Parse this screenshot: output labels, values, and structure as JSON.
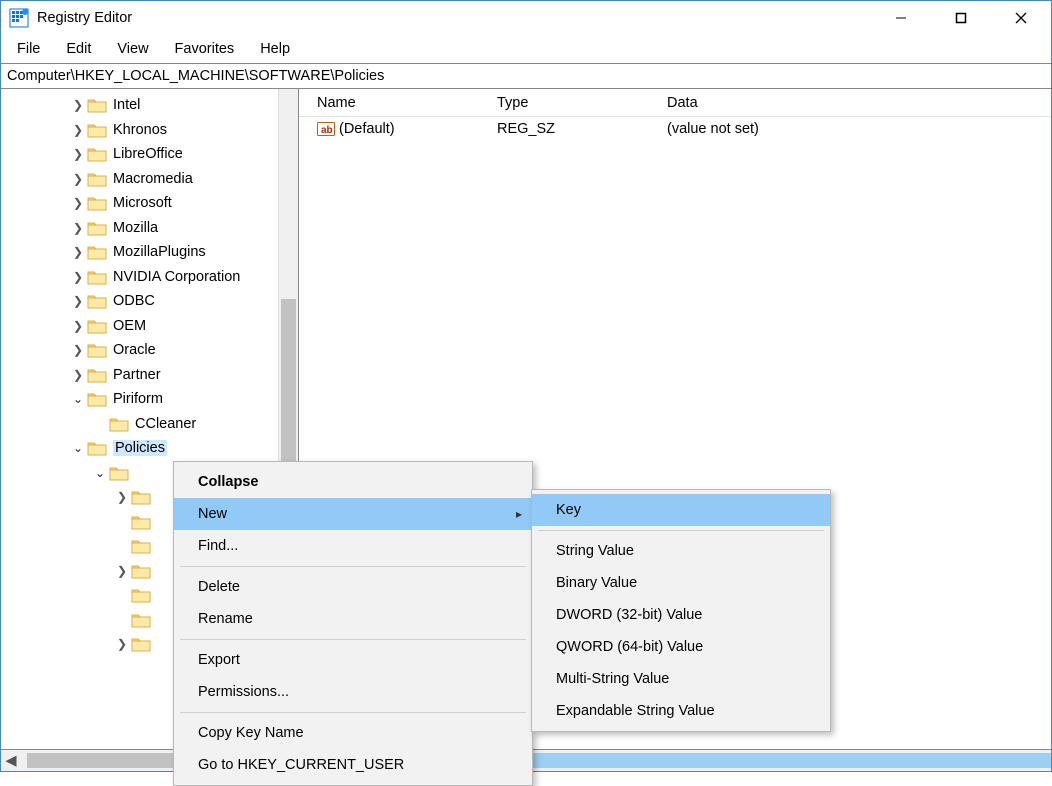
{
  "title": "Registry Editor",
  "menus": [
    "File",
    "Edit",
    "View",
    "Favorites",
    "Help"
  ],
  "address": "Computer\\HKEY_LOCAL_MACHINE\\SOFTWARE\\Policies",
  "tree": [
    {
      "indent": 2,
      "label": "Intel",
      "expand": "closed"
    },
    {
      "indent": 2,
      "label": "Khronos",
      "expand": "closed"
    },
    {
      "indent": 2,
      "label": "LibreOffice",
      "expand": "closed"
    },
    {
      "indent": 2,
      "label": "Macromedia",
      "expand": "closed"
    },
    {
      "indent": 2,
      "label": "Microsoft",
      "expand": "closed"
    },
    {
      "indent": 2,
      "label": "Mozilla",
      "expand": "closed"
    },
    {
      "indent": 2,
      "label": "MozillaPlugins",
      "expand": "closed"
    },
    {
      "indent": 2,
      "label": "NVIDIA Corporation",
      "expand": "closed"
    },
    {
      "indent": 2,
      "label": "ODBC",
      "expand": "closed"
    },
    {
      "indent": 2,
      "label": "OEM",
      "expand": "closed"
    },
    {
      "indent": 2,
      "label": "Oracle",
      "expand": "closed"
    },
    {
      "indent": 2,
      "label": "Partner",
      "expand": "closed"
    },
    {
      "indent": 2,
      "label": "Piriform",
      "expand": "open"
    },
    {
      "indent": 3,
      "label": "CCleaner",
      "expand": "none"
    },
    {
      "indent": 2,
      "label": "Policies",
      "expand": "open",
      "selected": true
    },
    {
      "indent": 3,
      "label": "",
      "expand": "open"
    },
    {
      "indent": 4,
      "label": "",
      "expand": "closed"
    },
    {
      "indent": 4,
      "label": "",
      "expand": "none"
    },
    {
      "indent": 4,
      "label": "",
      "expand": "none"
    },
    {
      "indent": 4,
      "label": "",
      "expand": "closed"
    },
    {
      "indent": 4,
      "label": "",
      "expand": "none"
    },
    {
      "indent": 4,
      "label": "",
      "expand": "none"
    },
    {
      "indent": 4,
      "label": "",
      "expand": "closed"
    }
  ],
  "columns": {
    "name": "Name",
    "type": "Type",
    "data": "Data"
  },
  "rows": [
    {
      "name": "(Default)",
      "type": "REG_SZ",
      "data": "(value not set)"
    }
  ],
  "ctx_main": {
    "collapse": "Collapse",
    "new": "New",
    "find": "Find...",
    "delete": "Delete",
    "rename": "Rename",
    "export": "Export",
    "permissions": "Permissions...",
    "copykey": "Copy Key Name",
    "gotohkcu": "Go to HKEY_CURRENT_USER"
  },
  "ctx_sub": {
    "key": "Key",
    "string": "String Value",
    "binary": "Binary Value",
    "dword": "DWORD (32-bit) Value",
    "qword": "QWORD (64-bit) Value",
    "multi": "Multi-String Value",
    "expand": "Expandable String Value"
  }
}
